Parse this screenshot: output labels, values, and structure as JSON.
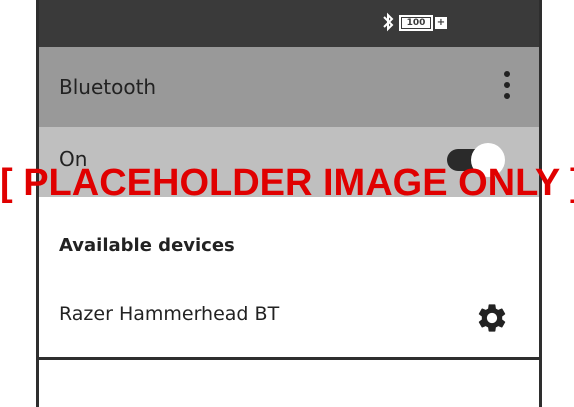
{
  "status_bar": {
    "bluetooth_icon": "bluetooth-icon",
    "battery_level": "100",
    "charging_symbol": "+"
  },
  "app_bar": {
    "title": "Bluetooth",
    "menu_icon": "more-vert-icon"
  },
  "bluetooth_toggle": {
    "label": "On",
    "state": "on"
  },
  "available_devices": {
    "header": "Available devices",
    "devices": [
      {
        "name": "Razer Hammerhead BT",
        "settings_icon": "gear-icon"
      }
    ]
  },
  "overlay": {
    "text": "[ PLACEHOLDER IMAGE ONLY ]"
  },
  "colors": {
    "status_bar_bg": "#3a3a3a",
    "app_bar_bg": "#999999",
    "toggle_row_bg": "#bfbfbf",
    "overlay_text": "#e00000"
  }
}
